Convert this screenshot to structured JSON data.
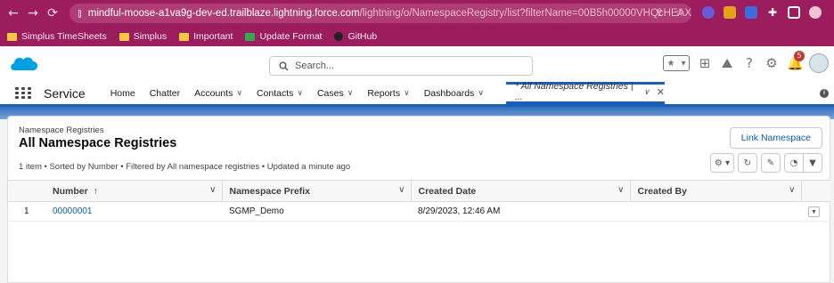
{
  "browser": {
    "url_host": "mindful-moose-a1va9g-dev-ed.trailblaze.lightning.force.com",
    "url_path": "/lightning/o/NamespaceRegistry/list?filterName=00B5h00000VHQcHEAX"
  },
  "bookmarks": [
    {
      "label": "Simplus TimeSheets"
    },
    {
      "label": "Simplus"
    },
    {
      "label": "Important"
    },
    {
      "label": "Update Format"
    },
    {
      "label": "GitHub"
    }
  ],
  "header": {
    "search_placeholder": "Search...",
    "notification_count": "5"
  },
  "nav": {
    "app_name": "Service",
    "items": [
      {
        "label": "Home",
        "has_menu": false
      },
      {
        "label": "Chatter",
        "has_menu": false
      },
      {
        "label": "Accounts",
        "has_menu": true
      },
      {
        "label": "Contacts",
        "has_menu": true
      },
      {
        "label": "Cases",
        "has_menu": true
      },
      {
        "label": "Reports",
        "has_menu": true
      },
      {
        "label": "Dashboards",
        "has_menu": true
      }
    ],
    "active_tab": "* All Namespace Registries | ..."
  },
  "list": {
    "breadcrumb": "Namespace Registries",
    "title": "All Namespace Registries",
    "action_button": "Link Namespace",
    "meta": "1 item • Sorted by Number • Filtered by All namespace registries • Updated a minute ago",
    "columns": [
      {
        "label": "Number",
        "sort_indicator": "↑"
      },
      {
        "label": "Namespace Prefix"
      },
      {
        "label": "Created Date"
      },
      {
        "label": "Created By"
      }
    ],
    "rows": [
      {
        "index": "1",
        "number": "00000001",
        "prefix": "SGMP_Demo",
        "created_date": "8/29/2023, 12:46 AM",
        "created_by": ""
      }
    ]
  },
  "colors": {
    "browser_frame": "#9b1d5e",
    "brand_blue": "#1b5fb5",
    "link_blue": "#0b5cab"
  }
}
